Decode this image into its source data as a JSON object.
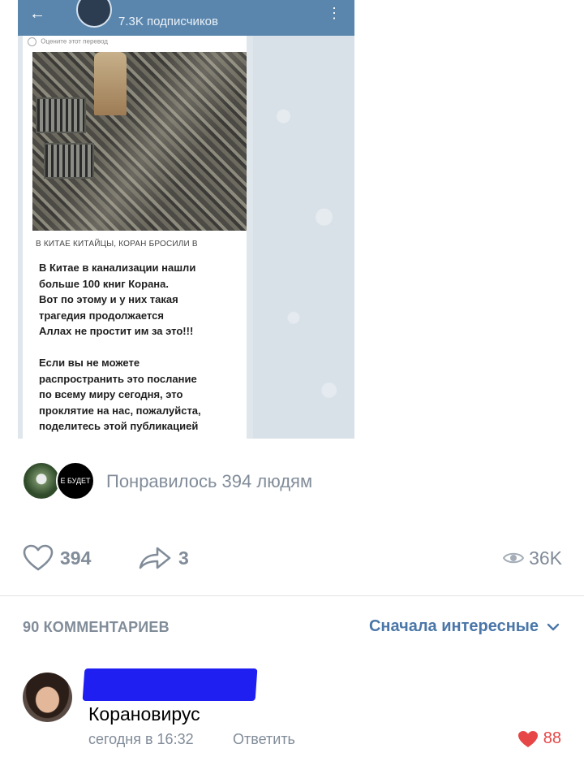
{
  "embedded_screenshot": {
    "subscribers": "7.3K подписчиков",
    "translate_hint": "Оцените этот перевод",
    "caption": "В КИТАЕ КИТАЙЦЫ, КОРАН БРОСИЛИ В",
    "message": "В Китае в канализации нашли\nбольше 100 книг Корана.\nВот по этому и у них такая\nтрагедия продолжается\nАллах не простит им за это!!!\n\nЕсли вы не можете\nраспространить это послание\nпо всему миру сегодня, это\nпроклятие на нас, пожалуйста,\nподелитесь этой публикацией"
  },
  "likes_summary": {
    "liker2_text": "Е БУДЕТ",
    "text": "Понравилось 394 людям"
  },
  "actions": {
    "likes": "394",
    "shares": "3",
    "views": "36K"
  },
  "comments": {
    "count_label": "90 КОММЕНТАРИЕВ",
    "sort_label": "Сначала интересные",
    "items": [
      {
        "text": "Кoрановирус",
        "time": "сегодня в 16:32",
        "reply_label": "Ответить",
        "likes": "88"
      }
    ]
  },
  "colors": {
    "accent": "#4a76a8",
    "muted": "#818c99",
    "like_red": "#e64646",
    "redaction": "#1f1ff2"
  }
}
